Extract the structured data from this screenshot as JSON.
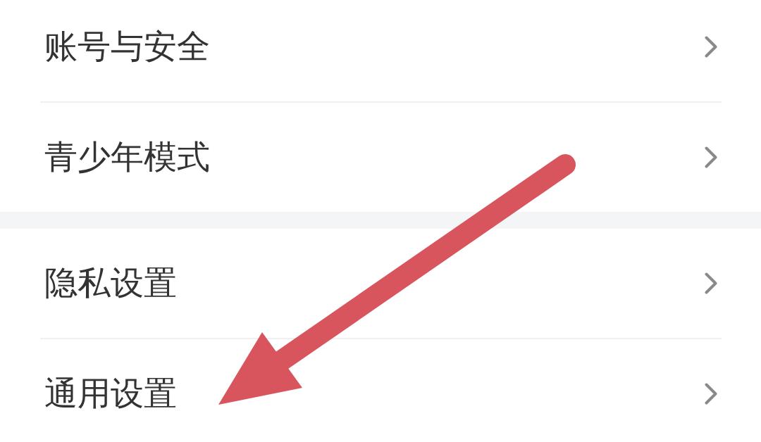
{
  "groups": [
    {
      "items": [
        {
          "label": "账号与安全"
        },
        {
          "label": "青少年模式"
        }
      ]
    },
    {
      "items": [
        {
          "label": "隐私设置"
        },
        {
          "label": "通用设置"
        }
      ]
    }
  ],
  "annotation": {
    "kind": "arrow"
  }
}
